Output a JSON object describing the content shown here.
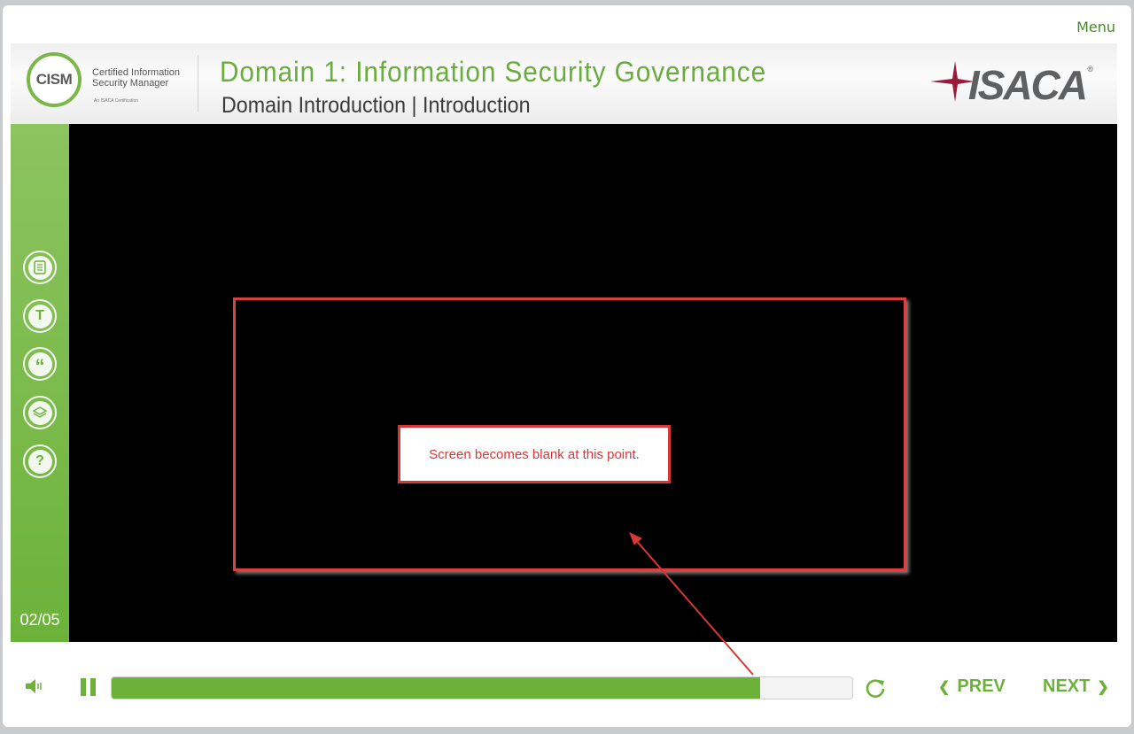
{
  "menu": {
    "label": "Menu"
  },
  "header": {
    "logo": {
      "acronym": "CISM",
      "line1": "Certified Information",
      "line2": "Security Manager",
      "sub": "An ISACA Certification"
    },
    "title": "Domain 1: Information Security Governance",
    "subtitle": "Domain Introduction | Introduction",
    "brand": "ISACA"
  },
  "sidebar": {
    "icons": [
      "notes-icon",
      "transcript-icon",
      "quote-icon",
      "layers-icon",
      "help-icon"
    ],
    "transcript_glyph": "T",
    "quote_glyph": "“",
    "help_glyph": "?",
    "page_indicator": "02/05"
  },
  "annotation": {
    "label": "Screen becomes blank at this point.",
    "color": "#d93636"
  },
  "controls": {
    "progress": 0.876,
    "prev_label": "PREV",
    "next_label": "NEXT",
    "accent_color": "#6cb23a"
  }
}
